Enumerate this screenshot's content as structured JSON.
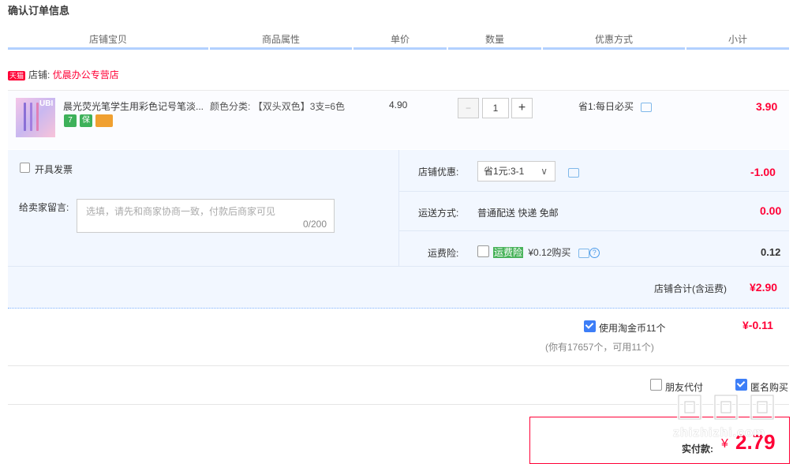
{
  "page": {
    "title": "确认订单信息"
  },
  "columns": [
    "店铺宝贝",
    "商品属性",
    "单价",
    "数量",
    "优惠方式",
    "小计"
  ],
  "shop": {
    "label": "店铺:",
    "name": "优晨办公专营店",
    "platform_badge": "天猫"
  },
  "item": {
    "title": "晨光荧光笔学生用彩色记号笔淡...",
    "attr_label": "颜色分类:",
    "attr_value": "【双头双色】3支=6色",
    "unit_price": "4.90",
    "quantity": "1",
    "minus": "−",
    "plus": "+",
    "discount": "省1:每日必买",
    "subtotal": "3.90",
    "badges": [
      "7",
      "保",
      "卡"
    ],
    "thumb_text": "UBI"
  },
  "invoice": {
    "label": "开具发票",
    "checked": false
  },
  "message": {
    "label": "给卖家留言:",
    "placeholder": "选填，请先和商家协商一致，付款后商家可见",
    "counter": "0/200"
  },
  "shop_discount": {
    "label": "店铺优惠:",
    "selected": "省1元:3-1",
    "amount": "-1.00"
  },
  "shipping": {
    "label": "运送方式:",
    "value": "普通配送 快递 免邮",
    "amount": "0.00"
  },
  "freight_insurance": {
    "label": "运费险:",
    "tag": "运费险",
    "price": "¥0.12购买",
    "amount": "0.12",
    "checked": false,
    "help": "?"
  },
  "shop_total": {
    "label": "店铺合计(含运费)",
    "amount": "¥2.90"
  },
  "coins": {
    "label": "使用淘金币11个",
    "checked": true,
    "amount": "¥-0.11",
    "note": "(你有17657个，可用11个)"
  },
  "options": {
    "friend_pay": "朋友代付",
    "friend_pay_checked": false,
    "anonymous": "匿名购买",
    "anonymous_checked": true
  },
  "payment": {
    "label": "实付款:",
    "currency": "¥",
    "amount": "2.79"
  },
  "watermark": {
    "text": "zhizhizhi.com"
  },
  "colors": {
    "accent_red": "#ff0036",
    "header_line": "#b2d1ff",
    "panel_bg": "#f2f7ff"
  }
}
